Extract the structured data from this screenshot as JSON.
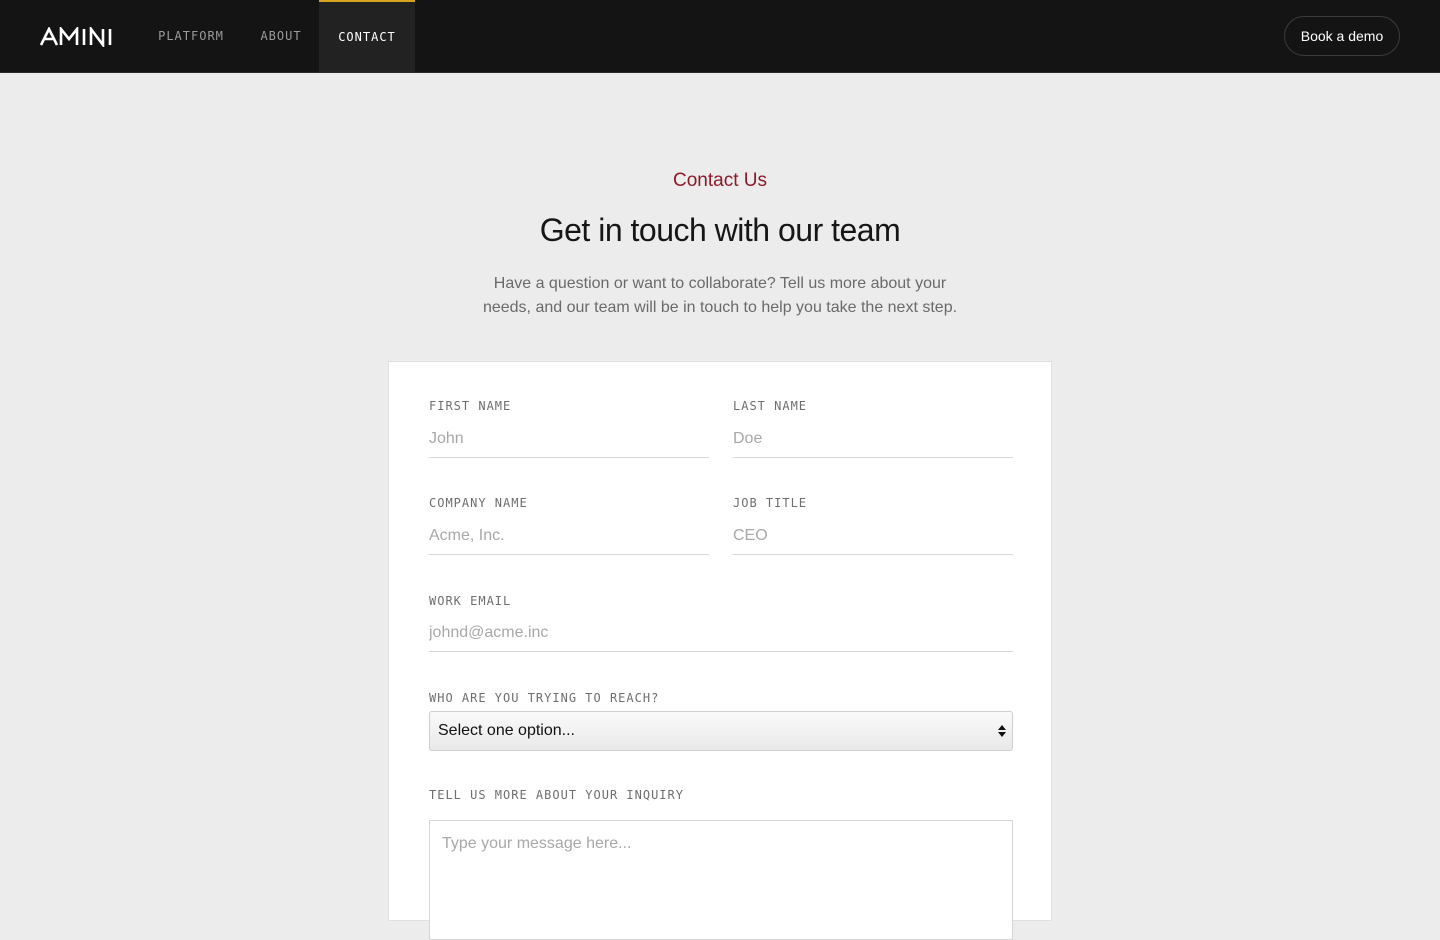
{
  "header": {
    "logo_text": "AMINI",
    "nav": [
      {
        "label": "PLATFORM"
      },
      {
        "label": "ABOUT"
      },
      {
        "label": "CONTACT",
        "active": true
      }
    ],
    "cta_label": "Book a demo",
    "accent_color": "#d9a520"
  },
  "hero": {
    "eyebrow": "Contact Us",
    "eyebrow_color": "#8b1a2b",
    "title": "Get in touch with our team",
    "description": "Have a question or want to collaborate? Tell us more about your needs, and our team will be in touch to help you take the next step."
  },
  "form": {
    "first_name": {
      "label": "FIRST NAME",
      "placeholder": "John",
      "value": ""
    },
    "last_name": {
      "label": "LAST NAME",
      "placeholder": "Doe",
      "value": ""
    },
    "company": {
      "label": "COMPANY NAME",
      "placeholder": "Acme, Inc.",
      "value": ""
    },
    "job_title": {
      "label": "JOB TITLE",
      "placeholder": "CEO",
      "value": ""
    },
    "email": {
      "label": "WORK EMAIL",
      "placeholder": "johnd@acme.inc",
      "value": ""
    },
    "reach": {
      "label": "WHO ARE YOU TRYING TO REACH?",
      "selected": "Select one option..."
    },
    "inquiry": {
      "label": "TELL US MORE ABOUT YOUR INQUIRY",
      "placeholder": "Type your message here...",
      "value": ""
    }
  }
}
